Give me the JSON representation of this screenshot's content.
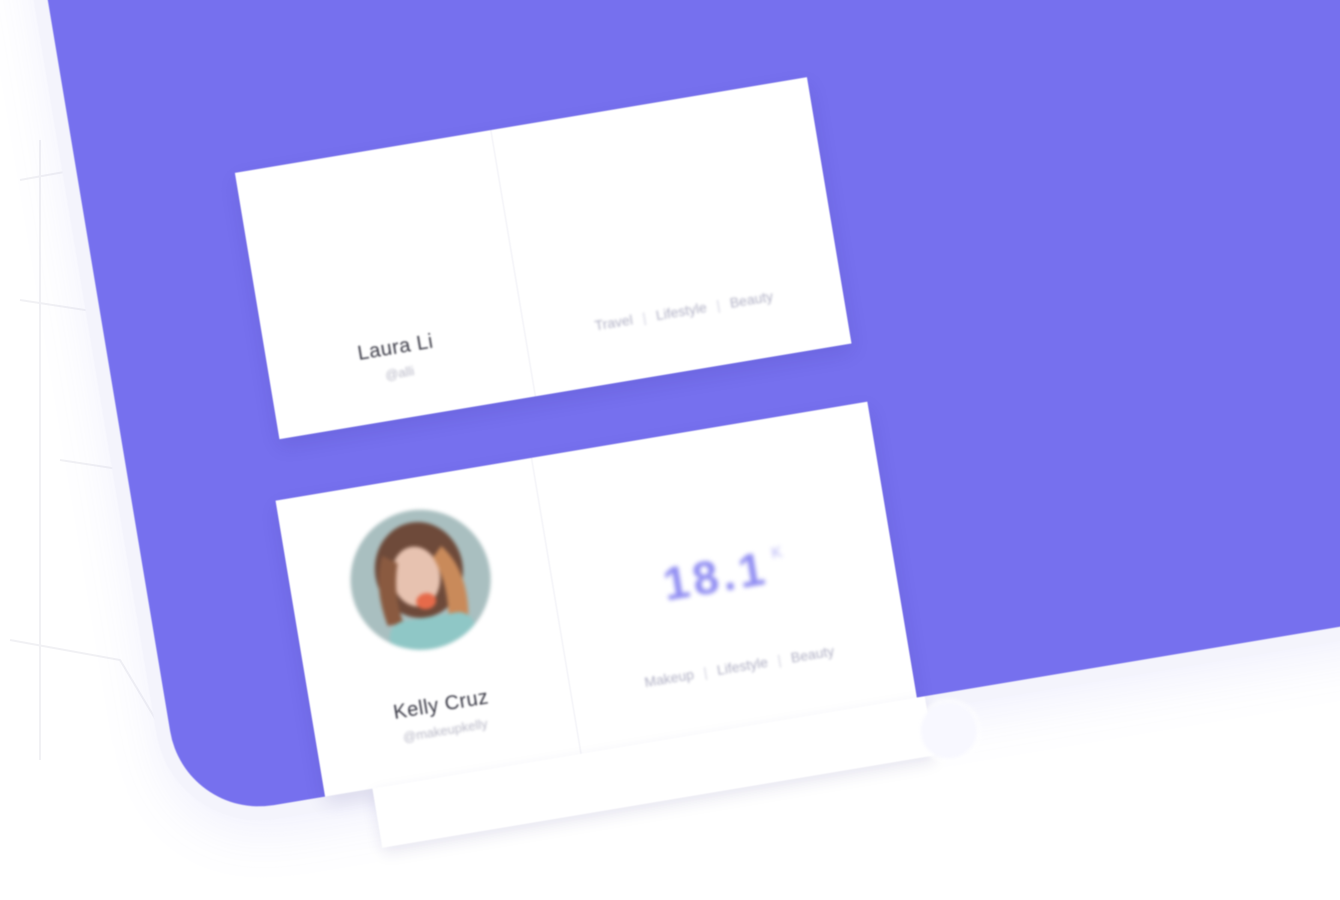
{
  "cards": [
    {
      "name": "Laura Li",
      "handle": "@alli",
      "tags": [
        "Travel",
        "Lifestyle",
        "Beauty"
      ]
    },
    {
      "name": "Kelly Cruz",
      "handle": "@makeupkelly",
      "stat_value": "18.1",
      "stat_unit": "K",
      "tags": [
        "Makeup",
        "Lifestyle",
        "Beauty"
      ]
    }
  ],
  "colors": {
    "device": "#7670ee",
    "accent": "#8f8cf2",
    "card": "#ffffff"
  }
}
